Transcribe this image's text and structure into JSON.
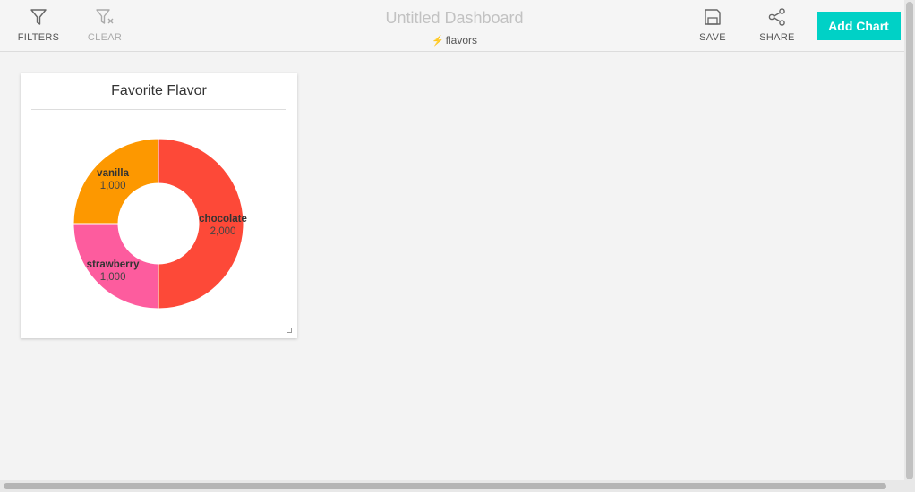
{
  "toolbar": {
    "filters_label": "FILTERS",
    "clear_label": "CLEAR",
    "save_label": "SAVE",
    "share_label": "SHARE",
    "add_chart_label": "Add Chart",
    "icons": {
      "filters": "funnel-icon",
      "clear": "funnel-clear-icon",
      "save": "floppy-disk-icon",
      "share": "share-icon",
      "source": "bolt-icon"
    }
  },
  "dashboard": {
    "title": "Untitled Dashboard",
    "source": "flavors"
  },
  "card": {
    "title": "Favorite Flavor"
  },
  "chart_data": {
    "type": "pie",
    "title": "Favorite Flavor",
    "categories": [
      "chocolate",
      "strawberry",
      "vanilla"
    ],
    "values": [
      2000,
      1000,
      1000
    ],
    "value_labels": [
      "2,000",
      "1,000",
      "1,000"
    ],
    "colors": [
      "#fd4938",
      "#fd5c9e",
      "#fd9800"
    ],
    "donut": true
  },
  "colors": {
    "accent": "#00d1c6",
    "title_muted": "#c2c2c2"
  }
}
